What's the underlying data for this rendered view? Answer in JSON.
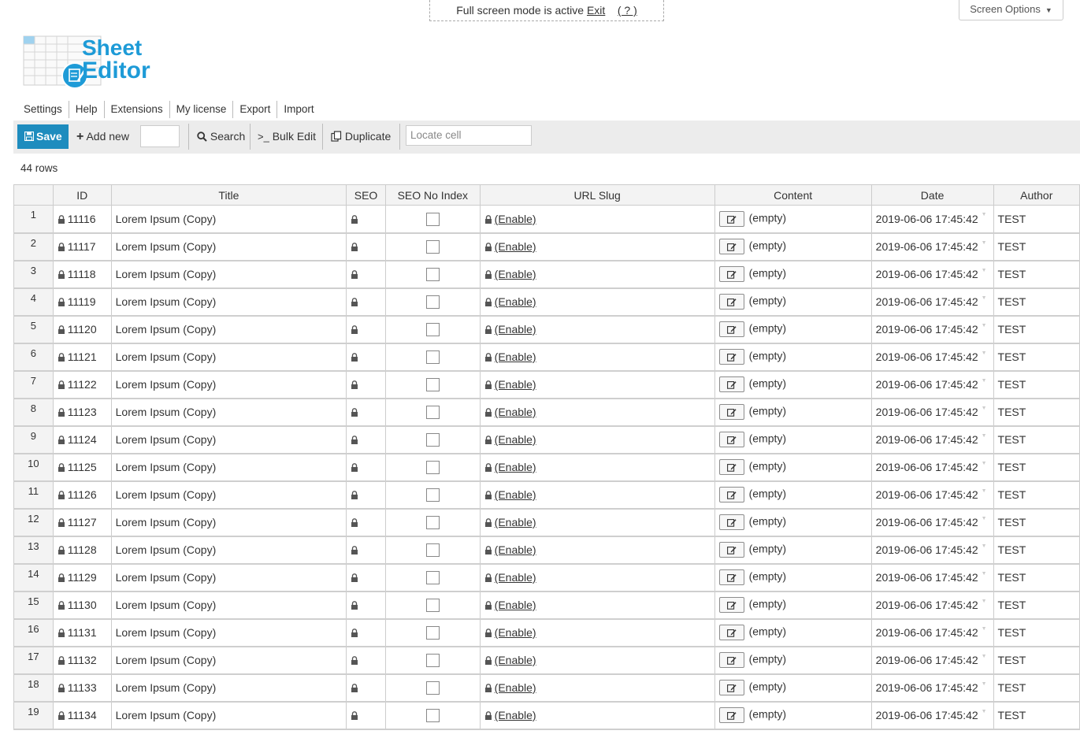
{
  "notice": {
    "text": "Full screen mode is active",
    "exit_label": "Exit",
    "help_label": "( ? )"
  },
  "screen_options": {
    "label": "Screen Options",
    "arrow": "▼"
  },
  "logo": {
    "line1": "Sheet",
    "line2": "Editor",
    "icon": "spreadsheet-edit-icon"
  },
  "menu": [
    "Settings",
    "Help",
    "Extensions",
    "My license",
    "Export",
    "Import"
  ],
  "toolbar": {
    "save_label": "Save",
    "add_new_label": "Add new",
    "search_label": "Search",
    "bulk_edit_label": "Bulk Edit",
    "duplicate_label": "Duplicate",
    "locate_placeholder": "Locate cell"
  },
  "rows_count": "44 rows",
  "columns": [
    "ID",
    "Title",
    "SEO",
    "SEO No Index",
    "URL Slug",
    "Content",
    "Date",
    "Author"
  ],
  "rows": [
    {
      "n": "1",
      "id": "11116",
      "title": "Lorem Ipsum (Copy)",
      "slug": "(Enable)",
      "content": "(empty)",
      "date": "2019-06-06 17:45:42",
      "author": "TEST"
    },
    {
      "n": "2",
      "id": "11117",
      "title": "Lorem Ipsum (Copy)",
      "slug": "(Enable)",
      "content": "(empty)",
      "date": "2019-06-06 17:45:42",
      "author": "TEST"
    },
    {
      "n": "3",
      "id": "11118",
      "title": "Lorem Ipsum (Copy)",
      "slug": "(Enable)",
      "content": "(empty)",
      "date": "2019-06-06 17:45:42",
      "author": "TEST"
    },
    {
      "n": "4",
      "id": "11119",
      "title": "Lorem Ipsum (Copy)",
      "slug": "(Enable)",
      "content": "(empty)",
      "date": "2019-06-06 17:45:42",
      "author": "TEST"
    },
    {
      "n": "5",
      "id": "11120",
      "title": "Lorem Ipsum (Copy)",
      "slug": "(Enable)",
      "content": "(empty)",
      "date": "2019-06-06 17:45:42",
      "author": "TEST"
    },
    {
      "n": "6",
      "id": "11121",
      "title": "Lorem Ipsum (Copy)",
      "slug": "(Enable)",
      "content": "(empty)",
      "date": "2019-06-06 17:45:42",
      "author": "TEST"
    },
    {
      "n": "7",
      "id": "11122",
      "title": "Lorem Ipsum (Copy)",
      "slug": "(Enable)",
      "content": "(empty)",
      "date": "2019-06-06 17:45:42",
      "author": "TEST"
    },
    {
      "n": "8",
      "id": "11123",
      "title": "Lorem Ipsum (Copy)",
      "slug": "(Enable)",
      "content": "(empty)",
      "date": "2019-06-06 17:45:42",
      "author": "TEST"
    },
    {
      "n": "9",
      "id": "11124",
      "title": "Lorem Ipsum (Copy)",
      "slug": "(Enable)",
      "content": "(empty)",
      "date": "2019-06-06 17:45:42",
      "author": "TEST"
    },
    {
      "n": "10",
      "id": "11125",
      "title": "Lorem Ipsum (Copy)",
      "slug": "(Enable)",
      "content": "(empty)",
      "date": "2019-06-06 17:45:42",
      "author": "TEST"
    },
    {
      "n": "11",
      "id": "11126",
      "title": "Lorem Ipsum (Copy)",
      "slug": "(Enable)",
      "content": "(empty)",
      "date": "2019-06-06 17:45:42",
      "author": "TEST"
    },
    {
      "n": "12",
      "id": "11127",
      "title": "Lorem Ipsum (Copy)",
      "slug": "(Enable)",
      "content": "(empty)",
      "date": "2019-06-06 17:45:42",
      "author": "TEST"
    },
    {
      "n": "13",
      "id": "11128",
      "title": "Lorem Ipsum (Copy)",
      "slug": "(Enable)",
      "content": "(empty)",
      "date": "2019-06-06 17:45:42",
      "author": "TEST"
    },
    {
      "n": "14",
      "id": "11129",
      "title": "Lorem Ipsum (Copy)",
      "slug": "(Enable)",
      "content": "(empty)",
      "date": "2019-06-06 17:45:42",
      "author": "TEST"
    },
    {
      "n": "15",
      "id": "11130",
      "title": "Lorem Ipsum (Copy)",
      "slug": "(Enable)",
      "content": "(empty)",
      "date": "2019-06-06 17:45:42",
      "author": "TEST"
    },
    {
      "n": "16",
      "id": "11131",
      "title": "Lorem Ipsum (Copy)",
      "slug": "(Enable)",
      "content": "(empty)",
      "date": "2019-06-06 17:45:42",
      "author": "TEST"
    },
    {
      "n": "17",
      "id": "11132",
      "title": "Lorem Ipsum (Copy)",
      "slug": "(Enable)",
      "content": "(empty)",
      "date": "2019-06-06 17:45:42",
      "author": "TEST"
    },
    {
      "n": "18",
      "id": "11133",
      "title": "Lorem Ipsum (Copy)",
      "slug": "(Enable)",
      "content": "(empty)",
      "date": "2019-06-06 17:45:42",
      "author": "TEST"
    },
    {
      "n": "19",
      "id": "11134",
      "title": "Lorem Ipsum (Copy)",
      "slug": "(Enable)",
      "content": "(empty)",
      "date": "2019-06-06 17:45:42",
      "author": "TEST"
    }
  ],
  "colors": {
    "accent": "#1e8cbe",
    "logo_blue": "#1e9bd7",
    "toolbar_bg": "#ececec"
  }
}
